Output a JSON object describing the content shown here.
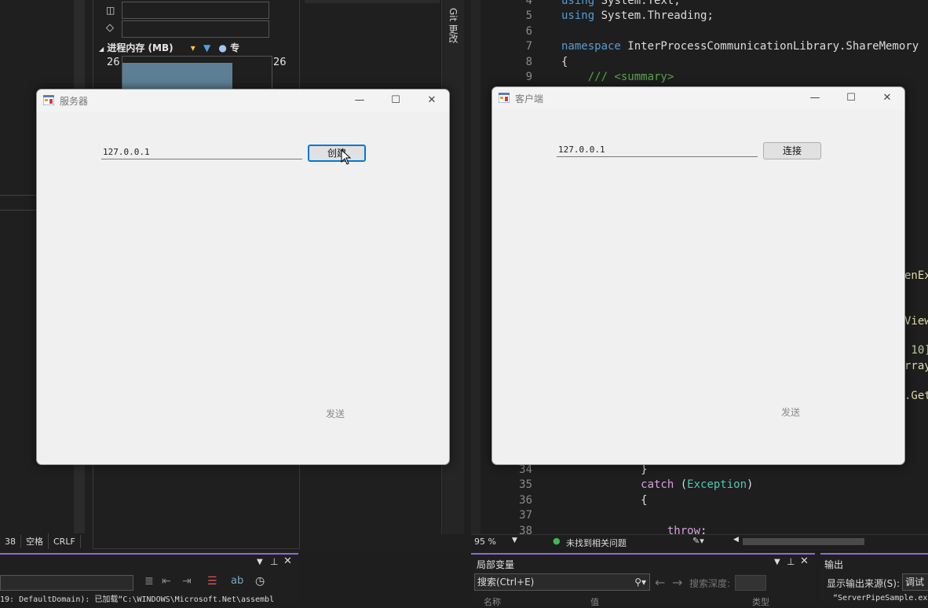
{
  "ide": {
    "diagnostics": {
      "memory_title": "进程内存 (MB)",
      "memory_legend_extra": "专",
      "memory_max_left": "26",
      "memory_max_right": "26"
    },
    "git_tab_label": "Git 更改",
    "status_left": [
      "38",
      "空格",
      "CRLF"
    ],
    "output_text": "19: DefaultDomain): 已加载“C:\\WINDOWS\\Microsoft.Net\\assembl",
    "editor": {
      "lines": [
        {
          "n": "4",
          "tokens": [
            [
              "kw",
              "using"
            ],
            [
              "",
              " System.Text;"
            ]
          ]
        },
        {
          "n": "5",
          "tokens": [
            [
              "kw",
              "using"
            ],
            [
              "",
              " System.Threading;"
            ]
          ]
        },
        {
          "n": "6",
          "tokens": []
        },
        {
          "n": "7",
          "tokens": [
            [
              "kw",
              "namespace"
            ],
            [
              "",
              " InterProcessCommunicationLibrary.ShareMemory"
            ]
          ]
        },
        {
          "n": "8",
          "tokens": [
            [
              "",
              "{"
            ]
          ]
        },
        {
          "n": "9",
          "tokens": [
            [
              "cm",
              "    /// <summary>"
            ]
          ]
        }
      ],
      "lower_lines": [
        {
          "n": "34",
          "tokens": [
            [
              "",
              "            }"
            ]
          ]
        },
        {
          "n": "35",
          "tokens": [
            [
              "kw2",
              "            catch"
            ],
            [
              "",
              " ("
            ],
            [
              "ty",
              "Exception"
            ],
            [
              "",
              ")"
            ]
          ]
        },
        {
          "n": "36",
          "tokens": [
            [
              "",
              "            {"
            ]
          ]
        },
        {
          "n": "37",
          "tokens": []
        },
        {
          "n": "38",
          "tokens": [
            [
              "kw2",
              "                throw"
            ],
            [
              "",
              ";"
            ]
          ]
        }
      ],
      "right_fragments": [
        "enEx",
        "View",
        " 10]",
        "rray",
        ".Get"
      ],
      "zoom": "95 %",
      "issues": "未找到相关问题"
    },
    "locals_panel": {
      "title": "局部变量",
      "search": "搜索(Ctrl+E)",
      "depth_label": "搜索深度:",
      "col_name": "名称",
      "col_value": "值",
      "col_type": "类型"
    },
    "output_panel": {
      "title": "输出",
      "source_label": "显示输出来源(S):",
      "source_value": "调试",
      "text": "“ServerPipeSample.ex"
    }
  },
  "server_window": {
    "title": "服务器",
    "address": "127.0.0.1",
    "create_label": "创建",
    "send_label": "发送"
  },
  "client_window": {
    "title": "客户端",
    "address": "127.0.0.1",
    "connect_label": "连接",
    "send_label": "发送"
  },
  "window_controls": {
    "minimize": "—",
    "maximize": "☐",
    "close": "✕"
  }
}
